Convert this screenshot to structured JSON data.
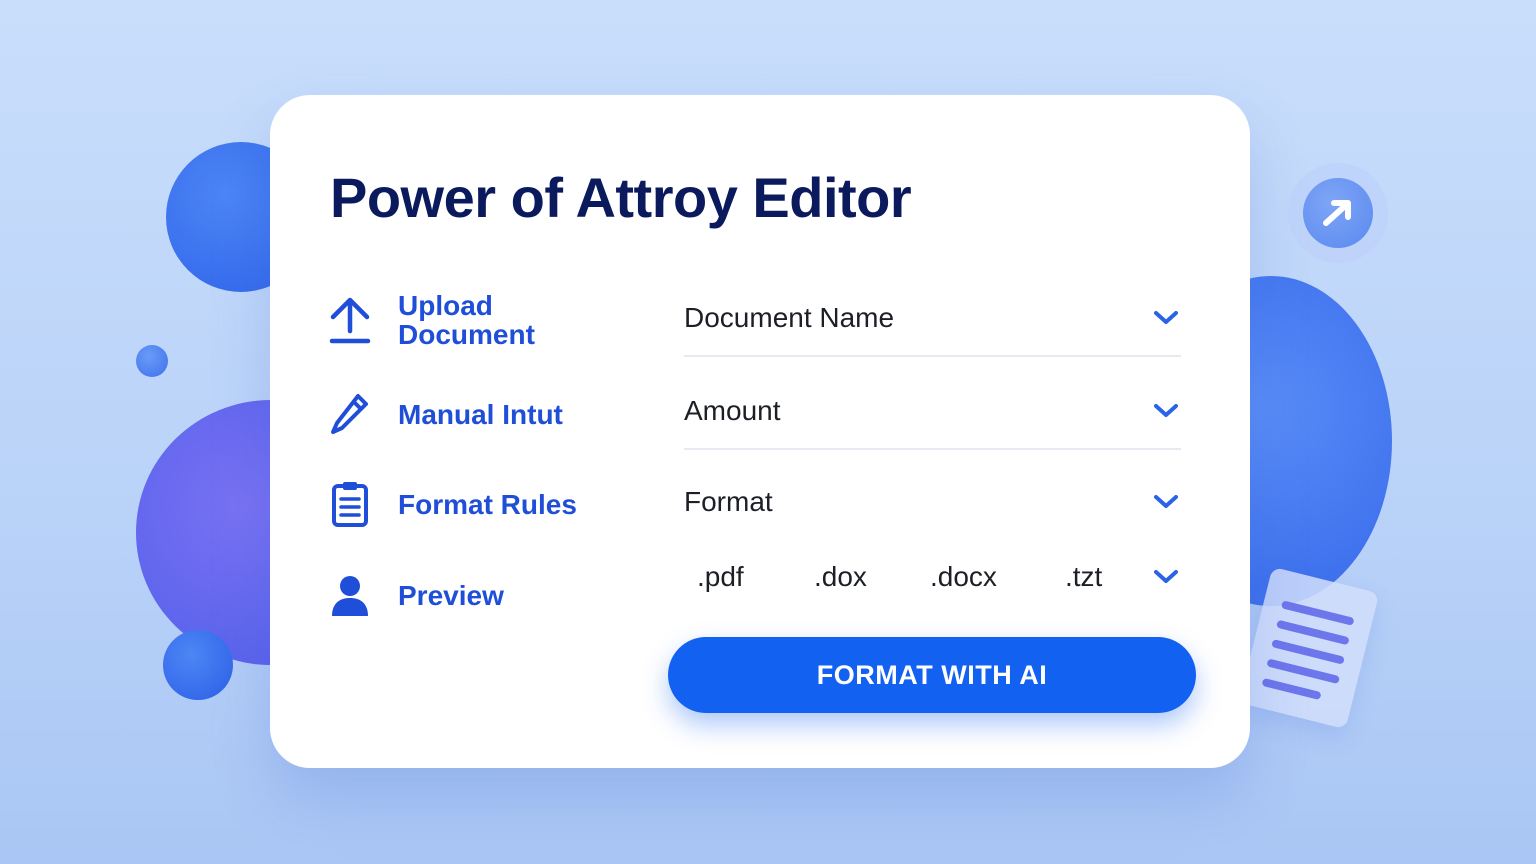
{
  "editor": {
    "title": "Power of Attroy Editor"
  },
  "sidebar": {
    "items": [
      {
        "label_line1": "Upload",
        "label_line2": "Document",
        "icon": "upload-icon"
      },
      {
        "label": "Manual Intut",
        "icon": "pencil-icon"
      },
      {
        "label": "Format Rules",
        "icon": "clipboard-icon"
      },
      {
        "label": "Preview",
        "icon": "user-icon"
      }
    ]
  },
  "fields": {
    "document_name": "Document Name",
    "amount": "Amount",
    "format": "Format"
  },
  "formats": {
    "options": [
      ".pdf",
      ".dox",
      ".docx",
      ".tzt"
    ]
  },
  "cta": {
    "label": "FORMAT WITH AI"
  },
  "colors": {
    "accent": "#1361f0",
    "title": "#0b1a5c",
    "link": "#1f4ed8"
  }
}
